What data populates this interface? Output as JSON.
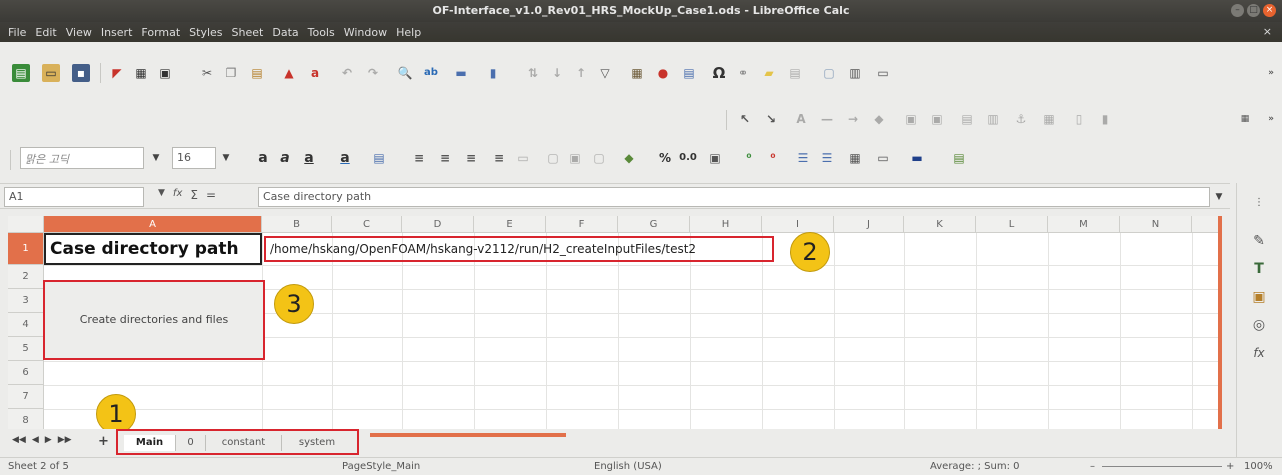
{
  "window": {
    "title": "OF-Interface_v1.0_Rev01_HRS_MockUp_Case1.ods - LibreOffice Calc",
    "buttons": [
      "–",
      "□",
      "×"
    ]
  },
  "menu": {
    "items": [
      "File",
      "Edit",
      "View",
      "Insert",
      "Format",
      "Styles",
      "Sheet",
      "Data",
      "Tools",
      "Window",
      "Help"
    ],
    "close_doc": "×"
  },
  "format_bar": {
    "font_name": "맑은 고딕",
    "font_size": "16",
    "percent": "%",
    "decimal": "0.0"
  },
  "formula_bar": {
    "cell_ref": "A1",
    "content": "Case directory path",
    "sum_symbol": "Σ",
    "equal_symbol": "=",
    "function_symbol": "fx"
  },
  "sheet": {
    "columns": [
      "A",
      "B",
      "C",
      "D",
      "E",
      "F",
      "G",
      "H",
      "I",
      "J",
      "K",
      "L",
      "M",
      "N"
    ],
    "rows": [
      "1",
      "2",
      "3",
      "4",
      "5",
      "6",
      "7",
      "8"
    ],
    "a1_text": "Case directory path",
    "b1_text": "/home/hskang/OpenFOAM/hskang-v2112/run/H2_createInputFiles/test2",
    "button_label": "Create directories and files"
  },
  "callouts": [
    "1",
    "2",
    "3"
  ],
  "tabs": {
    "items": [
      "Main",
      "0",
      "constant",
      "system"
    ],
    "active": "Main",
    "nav": [
      "◀◀",
      "◀",
      "▶",
      "▶▶"
    ],
    "add": "+"
  },
  "status": {
    "sheet_pos": "Sheet 2 of 5",
    "page_style": "PageStyle_Main",
    "language": "English (USA)",
    "aggregate": "Average: ; Sum: 0",
    "zoom": "100%",
    "zoom_minus": "–",
    "zoom_plus": "+"
  },
  "colors": {
    "accent": "#e2704a",
    "highlight": "#d8252e",
    "callout": "#f3c316"
  }
}
